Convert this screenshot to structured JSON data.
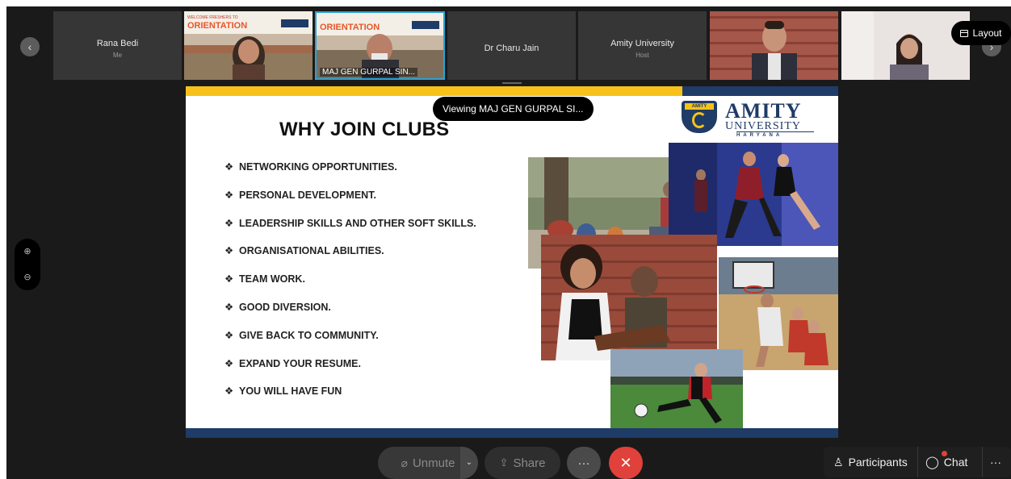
{
  "meeting": {
    "participants_strip": [
      {
        "name": "Rana Bedi",
        "sub": "Me"
      },
      {
        "name": "",
        "sub": "",
        "video_caption": "WELCOME FRESHERS TO ORIENTATION 2021"
      },
      {
        "name": "MAJ GEN GURPAL SIN...",
        "sub": "",
        "video_caption": "WELCOME FRESHERS TO ORIENTATION 2021"
      },
      {
        "name": "Dr Charu Jain",
        "sub": ""
      },
      {
        "name": "Amity University",
        "sub": "Host"
      },
      {
        "name": "",
        "sub": ""
      },
      {
        "name": "",
        "sub": ""
      }
    ],
    "layout_label": "Layout",
    "viewing_banner": "Viewing MAJ GEN GURPAL SI...",
    "zoom_in_symbol": "⊕",
    "zoom_out_symbol": "⊖"
  },
  "slide": {
    "title": "WHY JOIN CLUBS",
    "bullet_glyph": "❖",
    "bullets": [
      "NETWORKING OPPORTUNITIES.",
      "PERSONAL DEVELOPMENT.",
      "LEADERSHIP SKILLS AND OTHER SOFT SKILLS.",
      "ORGANISATIONAL ABILITIES.",
      "TEAM WORK.",
      "GOOD DIVERSION.",
      "GIVE BACK TO COMMUNITY.",
      "EXPAND YOUR RESUME.",
      "YOU WILL HAVE FUN"
    ],
    "logo": {
      "tag": "AMITY",
      "line1": "AMITY",
      "line2": "UNIVERSITY",
      "line3": "HARYANA"
    },
    "colors": {
      "yellow": "#f6c21a",
      "navy": "#1f3b67"
    }
  },
  "controls": {
    "unmute_label": "Unmute",
    "share_label": "Share",
    "more_symbol": "···",
    "end_symbol": "✕",
    "participants_label": "Participants",
    "chat_label": "Chat",
    "overflow_symbol": "···",
    "end_color": "#e0413a"
  }
}
